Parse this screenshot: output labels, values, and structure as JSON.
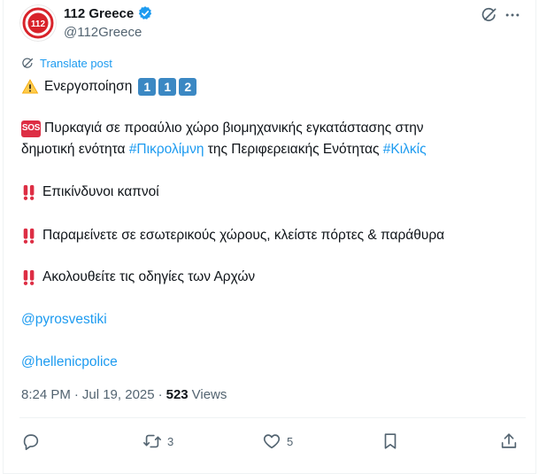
{
  "header": {
    "avatar_text": "112",
    "display_name": "112 Greece",
    "handle": "@112Greece"
  },
  "translate_label": "Translate post",
  "post": {
    "line1_text": "Ενεργοποίηση",
    "line1_keys": [
      "1",
      "1",
      "2"
    ],
    "sos_label": "SOS",
    "line2a": "Πυρκαγιά σε προαύλιο χώρο βιομηχανικής εγκατάστασης στην",
    "line2b_pre": "δημοτική ενότητα ",
    "hashtag1": "#Πικρολίμνη",
    "line2b_mid": " της Περιφερειακής Ενότητας ",
    "hashtag2": "#Κιλκίς",
    "line3": "Επικίνδυνοι καπνοί",
    "line4": "Παραμείνετε σε εσωτερικούς χώρους, κλείστε πόρτες & παράθυρα",
    "line5": "Ακολουθείτε τις οδηγίες των Αρχών",
    "mention1": "@pyrosvestiki",
    "mention2": "@hellenicpolice"
  },
  "meta": {
    "time": "8:24 PM",
    "dot": "·",
    "date": "Jul 19, 2025",
    "dot2": "·",
    "views_count": "523",
    "views_label": "Views"
  },
  "actions": {
    "reposts": "3",
    "likes": "5"
  },
  "colors": {
    "accent": "#1d9bf0",
    "text": "#0f1419",
    "muted": "#536471",
    "avatar_red": "#d8232a"
  }
}
